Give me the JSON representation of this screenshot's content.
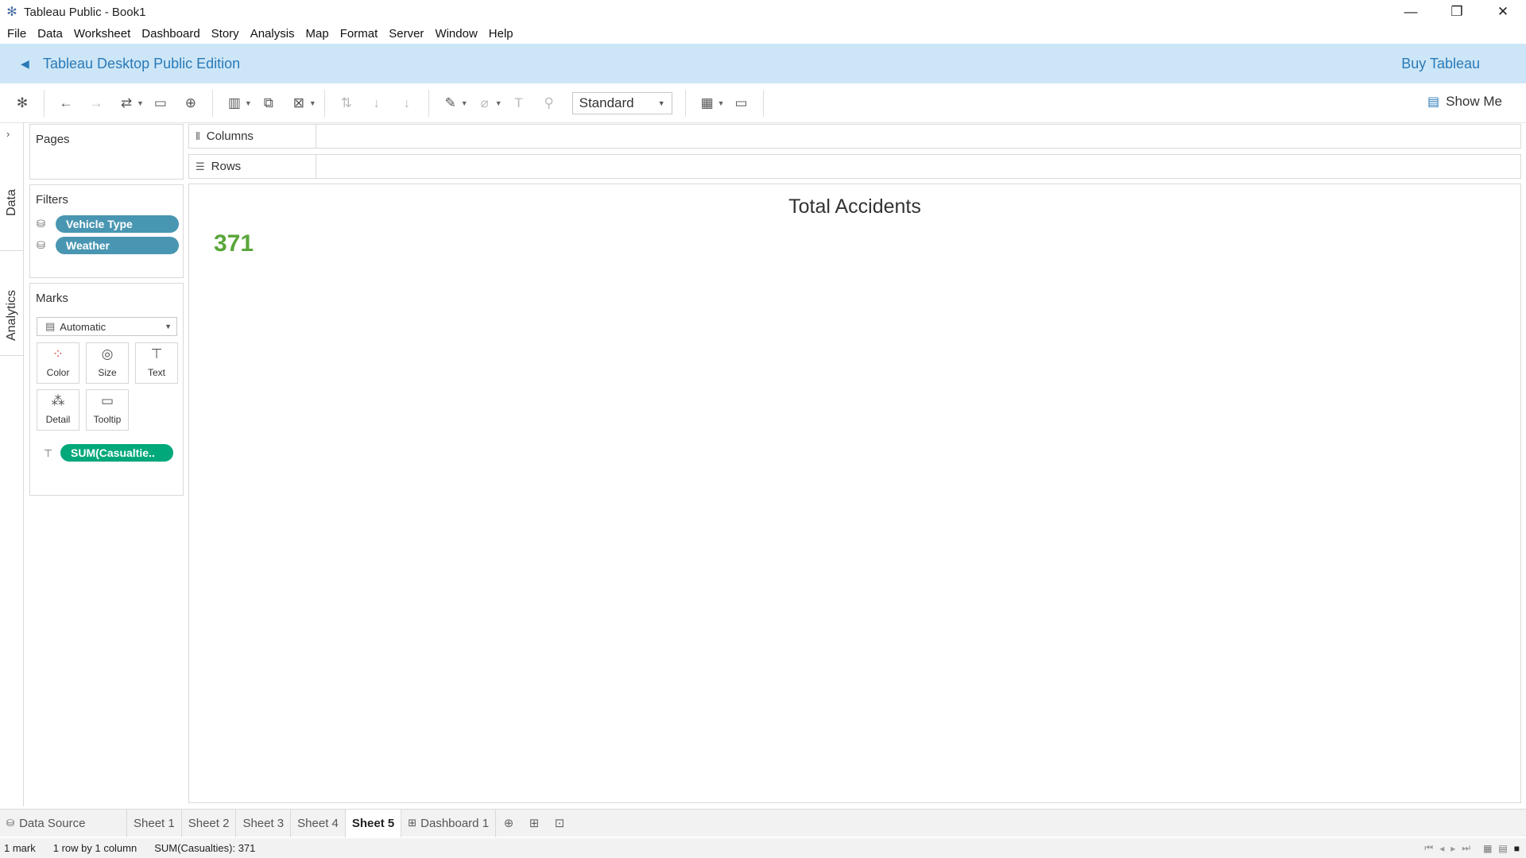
{
  "window": {
    "title": "Tableau Public - Book1",
    "minimize": "—",
    "restore": "❐",
    "close": "✕"
  },
  "menu": [
    "File",
    "Data",
    "Worksheet",
    "Dashboard",
    "Story",
    "Analysis",
    "Map",
    "Format",
    "Server",
    "Window",
    "Help"
  ],
  "banner": {
    "edition": "Tableau Desktop Public Edition",
    "buy": "Buy Tableau"
  },
  "toolbar": {
    "fit_select": "Standard",
    "show_me": "Show Me"
  },
  "side_tabs": {
    "data": "Data",
    "analytics": "Analytics"
  },
  "pages": {
    "header": "Pages"
  },
  "filters": {
    "header": "Filters",
    "items": [
      "Vehicle Type",
      "Weather"
    ]
  },
  "marks": {
    "header": "Marks",
    "type": "Automatic",
    "buttons": [
      "Color",
      "Size",
      "Text",
      "Detail",
      "Tooltip"
    ],
    "field": "SUM(Casualtie.."
  },
  "shelves": {
    "columns": "Columns",
    "rows": "Rows"
  },
  "view": {
    "title": "Total Accidents",
    "value": "371"
  },
  "tabs": {
    "data_source": "Data Source",
    "sheets": [
      "Sheet 1",
      "Sheet 2",
      "Sheet 3",
      "Sheet 4",
      "Sheet 5"
    ],
    "active": "Sheet 5",
    "dashboard": "Dashboard 1"
  },
  "status": {
    "marks": "1 mark",
    "dims": "1 row by 1 column",
    "sum": "SUM(Casualties): 371"
  },
  "colors": {
    "banner_bg": "#cde6f7",
    "banner_text": "#2a7ab8",
    "filter_pill": "#4996b2",
    "measure_pill": "#00a87a",
    "big_number": "#5aa63a"
  }
}
